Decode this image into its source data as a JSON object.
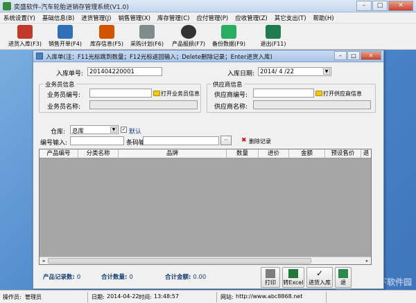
{
  "app": {
    "title": "奕盛软件-汽车轮胎进销存管理系统(V1.0)",
    "window_buttons": {
      "minimize": "–",
      "maximize": "□",
      "close": "✕"
    }
  },
  "menu": [
    "系统设置(Y)",
    "基础信息(B)",
    "进货管理(J)",
    "销售管理(X)",
    "库存管理(C)",
    "应付管理(P)",
    "应收管理(Z)",
    "其它支出(T)",
    "帮助(H)"
  ],
  "toolbar": [
    {
      "label": "进货入库(F3)",
      "icon": "stock-in-icon",
      "color": "#c0392b"
    },
    {
      "label": "销售开单(F4)",
      "icon": "sales-order-icon",
      "color": "#2e6fb7"
    },
    {
      "label": "库存信息(F5)",
      "icon": "warehouse-icon",
      "color": "#d35400"
    },
    {
      "label": "采购计划(F6)",
      "icon": "handshake-icon",
      "color": "#7f8c8d"
    },
    {
      "label": "产品报损(F7)",
      "icon": "tire-icon",
      "color": "#333333"
    },
    {
      "label": "备份数据(F9)",
      "icon": "backup-icon",
      "color": "#27ae60"
    },
    {
      "label": "退出(F11)",
      "icon": "exit-icon",
      "color": "#1f7a4d"
    }
  ],
  "dialog": {
    "title": "入库单(注：F11光标跳到数量；F12光标返回输入；Delete删除记录；Enter进货入库)",
    "window_buttons": {
      "minimize": "–",
      "maximize": "□",
      "close": "✕"
    },
    "order_no_label": "入库单号:",
    "order_no_value": "201404220001",
    "date_label": "入库日期:",
    "date_value": "2014/ 4 /22",
    "salesperson_group": "业务员信息",
    "salesperson_id_label": "业务员编号:",
    "salesperson_id_value": "",
    "open_salesperson": "打开业务员信息",
    "salesperson_name_label": "业务员名称:",
    "salesperson_name_value": "",
    "supplier_group": "供应商信息",
    "supplier_id_label": "供应商编号:",
    "supplier_id_value": "",
    "open_supplier": "打开供应商信息",
    "supplier_name_label": "供应商名称:",
    "supplier_name_value": "",
    "warehouse_label": "仓库:",
    "warehouse_value": "总库",
    "default_label": "默认",
    "default_checked": true,
    "code_input_label": "编号输入:",
    "code_input_value": "",
    "barcode_label": "条码输入:",
    "barcode_value": "",
    "ellipsis": "··",
    "delete_record": "删除记录",
    "columns": [
      "产品编号",
      "分类名称",
      "品牌",
      "数量",
      "进价",
      "金额",
      "预设售价",
      "退"
    ],
    "scroll_left": "◂",
    "scroll_right": "▸",
    "summary": {
      "count_label": "产品记录数:",
      "count_value": "0",
      "qty_label": "合计数量:",
      "qty_value": "0",
      "amount_label": "合计金额:",
      "amount_value": "0.00"
    },
    "buttons": [
      "打印",
      "转Excel",
      "进货入库",
      "退"
    ]
  },
  "status": {
    "operator_label": "操作员:",
    "operator_value": "管理员",
    "date_label": "日期:",
    "date_value": "2014-04-22",
    "time_label": "时间:",
    "time_value": "13:48:57",
    "website_label": "网站:",
    "website_value": "http://www.abc8868.net"
  },
  "watermark": "当下软件园"
}
